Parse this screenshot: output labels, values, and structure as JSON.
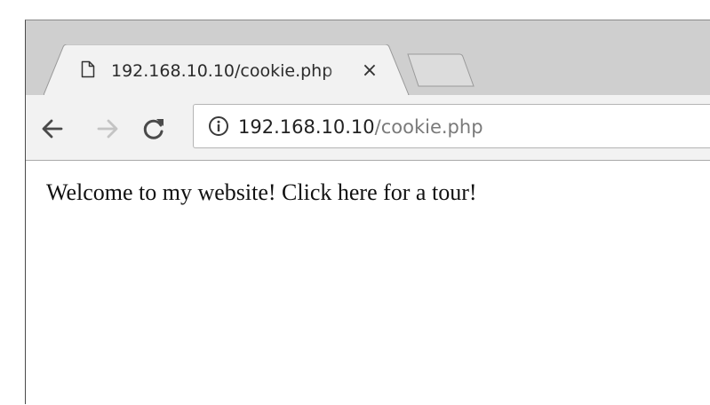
{
  "tab": {
    "title": "192.168.10.10/cookie.php",
    "close_glyph": "×",
    "icon": "file-icon"
  },
  "new_tab": {
    "icon": "new-tab-icon"
  },
  "toolbar": {
    "back_icon": "arrow-left-icon",
    "forward_icon": "arrow-right-icon",
    "reload_icon": "reload-icon"
  },
  "address_bar": {
    "info_icon": "info-icon",
    "host": "192.168.10.10",
    "path": "/cookie.php"
  },
  "page": {
    "body_text": "Welcome to my website! Click here for a tour!"
  },
  "colors": {
    "tabstrip": "#cfcfcf",
    "toolbar": "#f2f2f2",
    "url_host": "#222222",
    "url_path": "#7a7a7a",
    "forward_disabled": "#c4c4c4"
  }
}
